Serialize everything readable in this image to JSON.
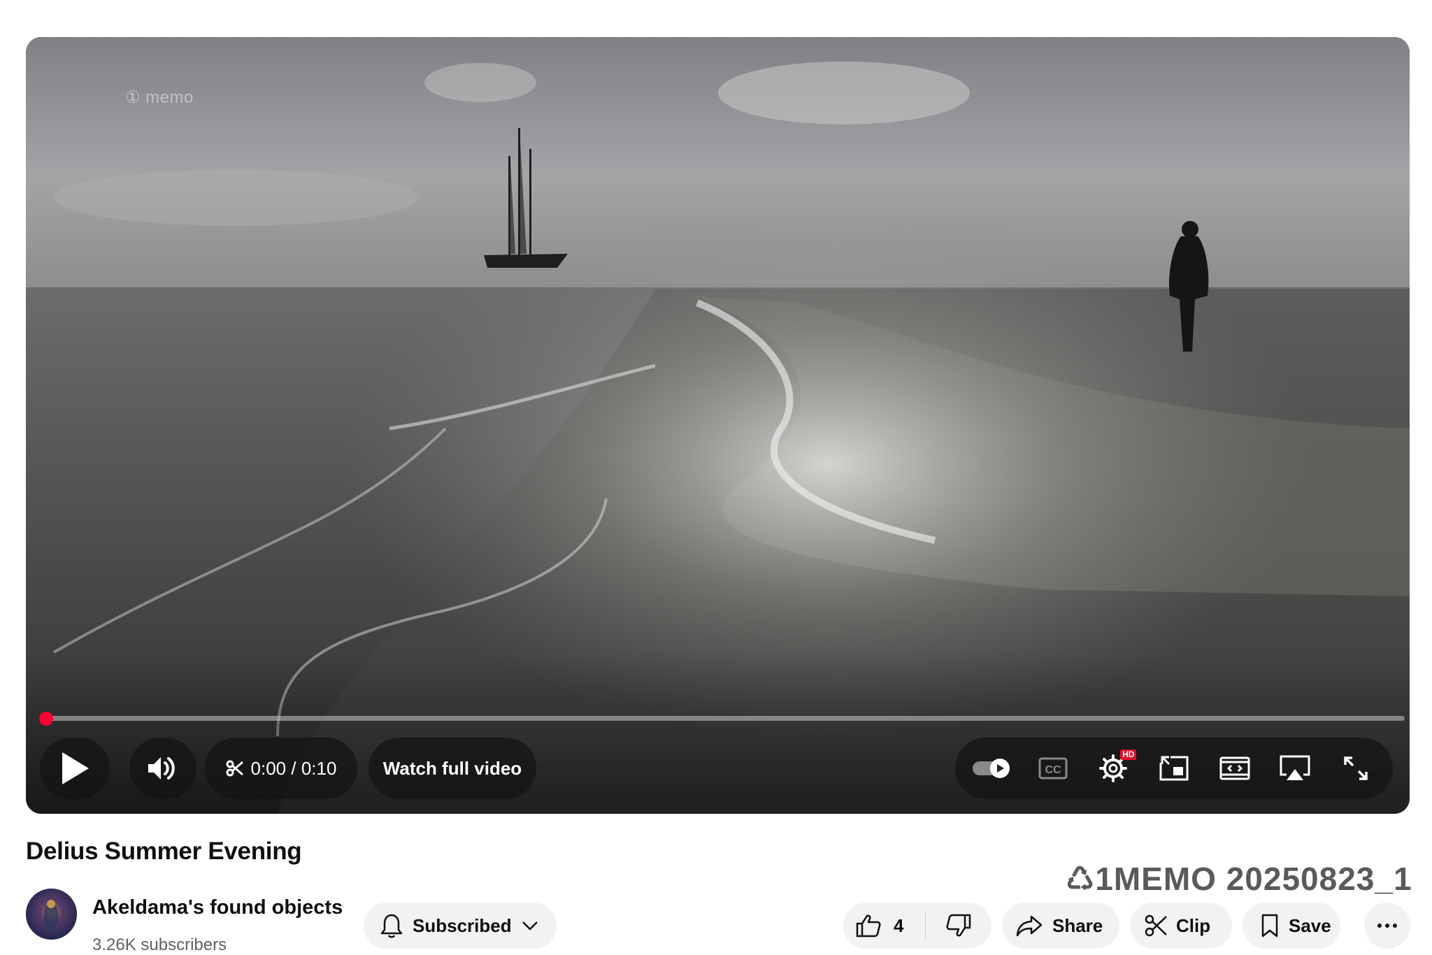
{
  "video": {
    "watermark": "① memo",
    "progress": 0.0,
    "time_current": "0:00",
    "time_separator": "/",
    "time_duration": "0:10",
    "watch_full_label": "Watch full video",
    "icons": {
      "play": "play-icon",
      "volume": "volume-icon",
      "clip_scissors": "scissors-icon",
      "autoplay": "autoplay-toggle-icon",
      "captions": "cc-icon",
      "settings": "gear-icon",
      "miniplayer": "miniplayer-icon",
      "theater": "theater-mode-icon",
      "airplay": "airplay-icon",
      "fullscreen": "fullscreen-icon"
    },
    "settings_badge": "HD",
    "captions_label": "CC"
  },
  "details": {
    "title": "Delius Summer Evening",
    "channel_name": "Akeldama's found  objects",
    "subscribers": "3.26K subscribers",
    "subscribed_label": "Subscribed",
    "overlay_text": "♺1MEMO 20250823_1",
    "like_count": "4",
    "share_label": "Share",
    "clip_label": "Clip",
    "save_label": "Save"
  },
  "colors": {
    "progress_accent": "#ff0033",
    "button_bg": "#f2f2f2",
    "subtext": "#606060"
  }
}
